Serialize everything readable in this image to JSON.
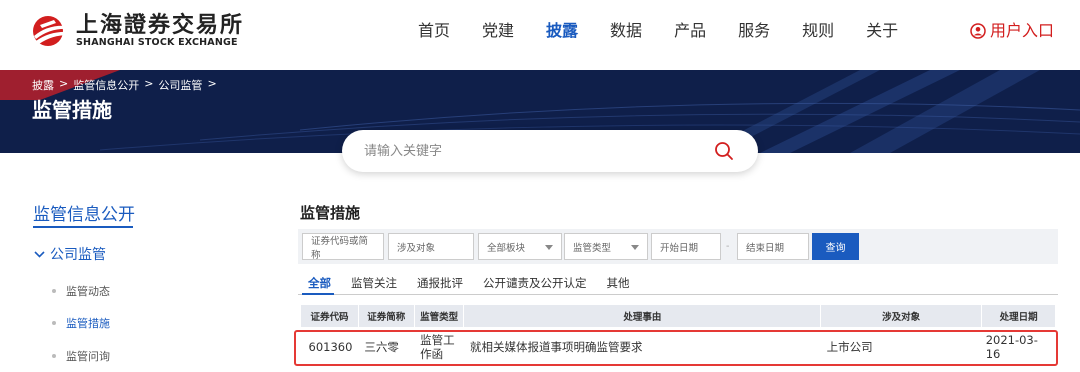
{
  "header": {
    "logo_cn": "上海證券交易所",
    "logo_en": "SHANGHAI STOCK EXCHANGE",
    "nav": [
      {
        "label": "首页",
        "active": false
      },
      {
        "label": "党建",
        "active": false
      },
      {
        "label": "披露",
        "active": true
      },
      {
        "label": "数据",
        "active": false
      },
      {
        "label": "产品",
        "active": false
      },
      {
        "label": "服务",
        "active": false
      },
      {
        "label": "规则",
        "active": false
      },
      {
        "label": "关于",
        "active": false
      }
    ],
    "user_entry": "用户入口"
  },
  "banner": {
    "breadcrumb": [
      "披露",
      ">",
      "监管信息公开",
      ">",
      "公司监管",
      ">"
    ],
    "title": "监管措施"
  },
  "search": {
    "placeholder": "请输入关键字"
  },
  "sidebar": {
    "title": "监管信息公开",
    "group": "公司监管",
    "items": [
      "监管动态",
      "监管措施",
      "监管问询"
    ],
    "active_item": "监管措施"
  },
  "main": {
    "title": "监管措施",
    "filters": {
      "code_placeholder": "证券代码或简称",
      "target_placeholder": "涉及对象",
      "board": "全部板块",
      "type": "监管类型",
      "start_date": "开始日期",
      "separator": "-",
      "end_date": "结束日期",
      "query": "查询"
    },
    "tabs": [
      "全部",
      "监管关注",
      "通报批评",
      "公开谴责及公开认定",
      "其他"
    ],
    "active_tab": "全部",
    "table": {
      "headers": [
        "证券代码",
        "证券简称",
        "监管类型",
        "处理事由",
        "涉及对象",
        "处理日期"
      ],
      "rows": [
        [
          "601360",
          "三六零",
          "监管工作函",
          "就相关媒体报道事项明确监管要求",
          "上市公司",
          "2021-03-16"
        ]
      ]
    }
  },
  "colors": {
    "accent": "#1a5bbf",
    "brand_red": "#d21e1e",
    "banner": "#0f1f4a",
    "highlight": "#e53935"
  }
}
